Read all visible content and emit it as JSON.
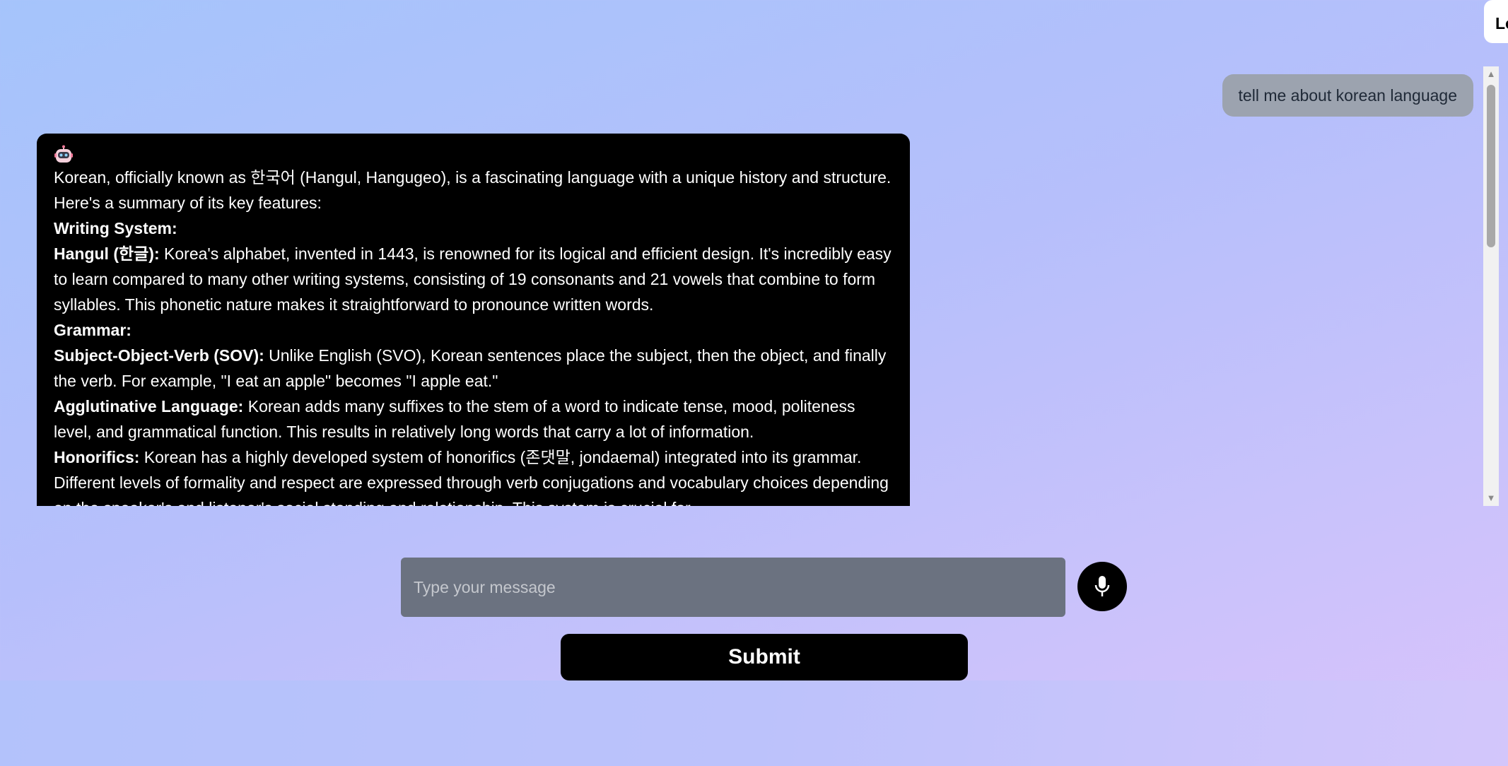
{
  "header": {
    "corner_label": "Lo"
  },
  "chat": {
    "user_message": "tell me about korean language",
    "bot_response": {
      "intro": "Korean, officially known as 한국어 (Hangul, Hangugeo), is a fascinating language with a unique history and structure. Here's a summary of its key features:",
      "section_writing": "Writing System:",
      "hangul_label": "Hangul (한글):",
      "hangul_text": " Korea's alphabet, invented in 1443, is renowned for its logical and efficient design. It's incredibly easy to learn compared to many other writing systems, consisting of 19 consonants and 21 vowels that combine to form syllables. This phonetic nature makes it straightforward to pronounce written words.",
      "section_grammar": "Grammar:",
      "sov_label": "Subject-Object-Verb (SOV):",
      "sov_text": " Unlike English (SVO), Korean sentences place the subject, then the object, and finally the verb. For example, \"I eat an apple\" becomes \"I apple eat.\"",
      "agglutinative_label": "Agglutinative Language:",
      "agglutinative_text": " Korean adds many suffixes to the stem of a word to indicate tense, mood, politeness level, and grammatical function. This results in relatively long words that carry a lot of information.",
      "honorifics_label": "Honorifics:",
      "honorifics_text": " Korean has a highly developed system of honorifics (존댓말, jondaemal) integrated into its grammar. Different levels of formality and respect are expressed through verb conjugations and vocabulary choices depending on the speaker's and listener's social standing and relationship. This system is crucial for"
    }
  },
  "composer": {
    "placeholder": "Type your message",
    "submit_label": "Submit",
    "mic_icon": "microphone-icon"
  },
  "colors": {
    "bot_bubble_bg": "#000000",
    "user_bubble_bg": "#9ca3af",
    "input_bg": "#6b7280",
    "button_bg": "#000000"
  }
}
